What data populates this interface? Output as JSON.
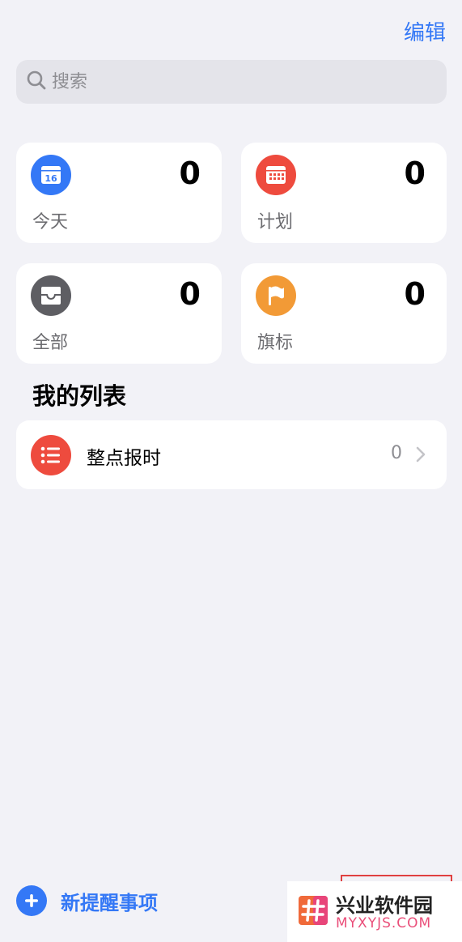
{
  "header": {
    "edit_label": "编辑"
  },
  "search": {
    "placeholder": "搜索"
  },
  "smart_lists": [
    {
      "label": "今天",
      "count": "0",
      "icon": "calendar-today-icon",
      "icon_day": "16",
      "color": "#3478f6"
    },
    {
      "label": "计划",
      "count": "0",
      "icon": "calendar-grid-icon",
      "color": "#ee4b3e"
    },
    {
      "label": "全部",
      "count": "0",
      "icon": "tray-icon",
      "color": "#5e5e63"
    },
    {
      "label": "旗标",
      "count": "0",
      "icon": "flag-icon",
      "color": "#f29a36"
    }
  ],
  "my_lists": {
    "title": "我的列表",
    "items": [
      {
        "name": "整点报时",
        "count": "0",
        "icon": "list-bullet-icon",
        "color": "#ee4b3e"
      }
    ]
  },
  "footer": {
    "new_reminder_label": "新提醒事项"
  },
  "watermark": {
    "name_cn": "兴业软件园",
    "name_en": "MYXYJS.COM"
  },
  "colors": {
    "accent": "#3478f6",
    "background": "#f2f2f7",
    "card": "#ffffff"
  }
}
